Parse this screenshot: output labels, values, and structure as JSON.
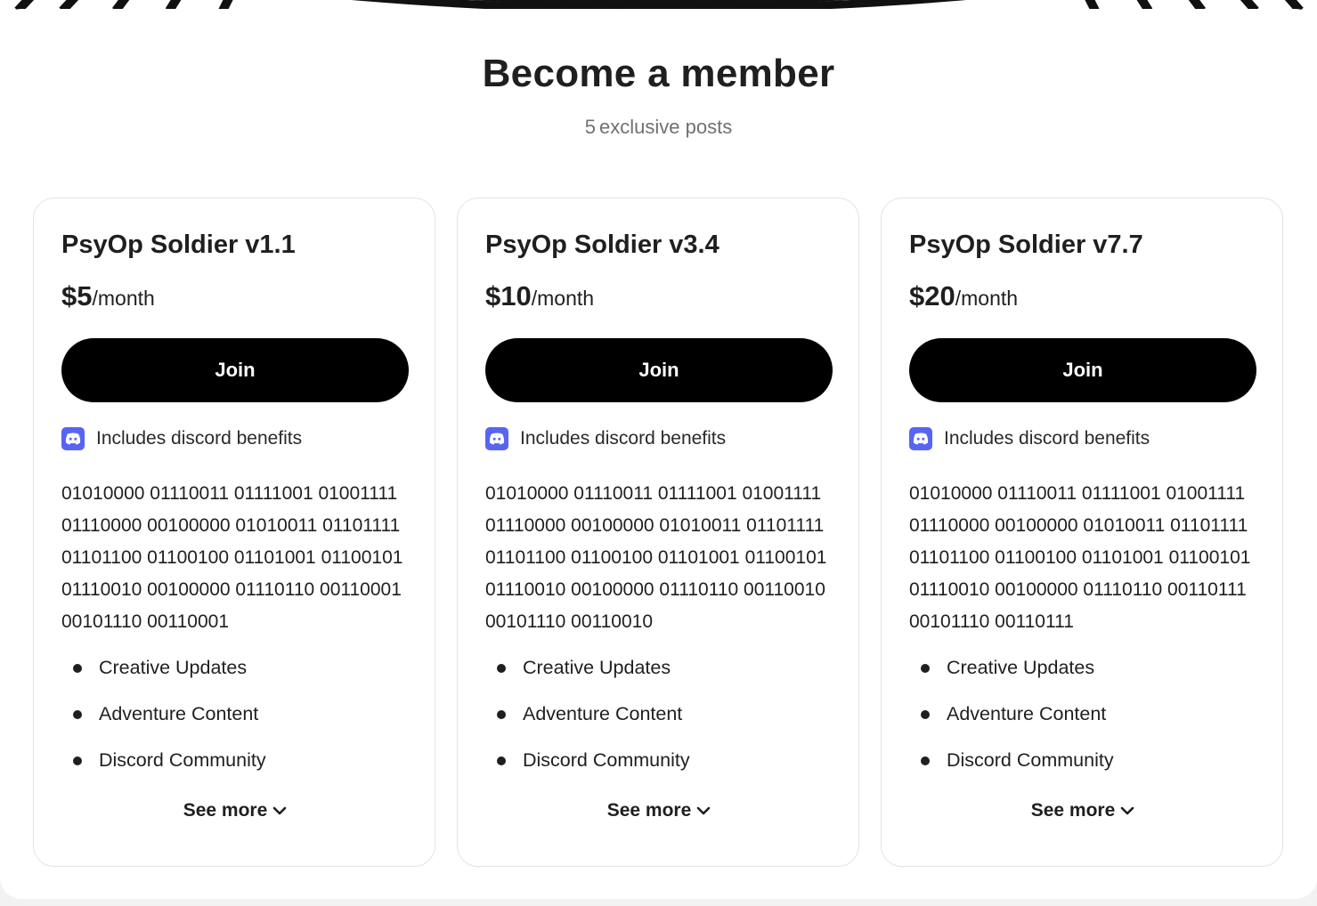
{
  "header": {
    "title": "Become a member",
    "post_count": "5",
    "post_label": "exclusive posts"
  },
  "tiers": [
    {
      "name": "PsyOp Soldier v1.1",
      "price": "$5",
      "period": "/month",
      "join_label": "Join",
      "discord_label": "Includes discord benefits",
      "description": "01010000 01110011 01111001 01001111 01110000 00100000 01010011 01101111 01101100 01100100 01101001 01100101 01110010 00100000 01110110 00110001 00101110 00110001",
      "benefits": [
        "Creative Updates",
        "Adventure Content",
        "Discord Community"
      ],
      "see_more_label": "See more"
    },
    {
      "name": "PsyOp Soldier v3.4",
      "price": "$10",
      "period": "/month",
      "join_label": "Join",
      "discord_label": "Includes discord benefits",
      "description": "01010000 01110011 01111001 01001111 01110000 00100000 01010011 01101111 01101100 01100100 01101001 01100101 01110010 00100000 01110110 00110010 00101110 00110010",
      "benefits": [
        "Creative Updates",
        "Adventure Content",
        "Discord Community"
      ],
      "see_more_label": "See more"
    },
    {
      "name": "PsyOp Soldier v7.7",
      "price": "$20",
      "period": "/month",
      "join_label": "Join",
      "discord_label": "Includes discord benefits",
      "description": "01010000 01110011 01111001 01001111 01110000 00100000 01010011 01101111 01101100 01100100 01101001 01100101 01110010 00100000 01110110 00110111 00101110 00110111",
      "benefits": [
        "Creative Updates",
        "Adventure Content",
        "Discord Community"
      ],
      "see_more_label": "See more"
    }
  ],
  "colors": {
    "discord": "#5865f2",
    "button": "#000000",
    "text": "#1f1f1f",
    "muted": "#707070"
  }
}
